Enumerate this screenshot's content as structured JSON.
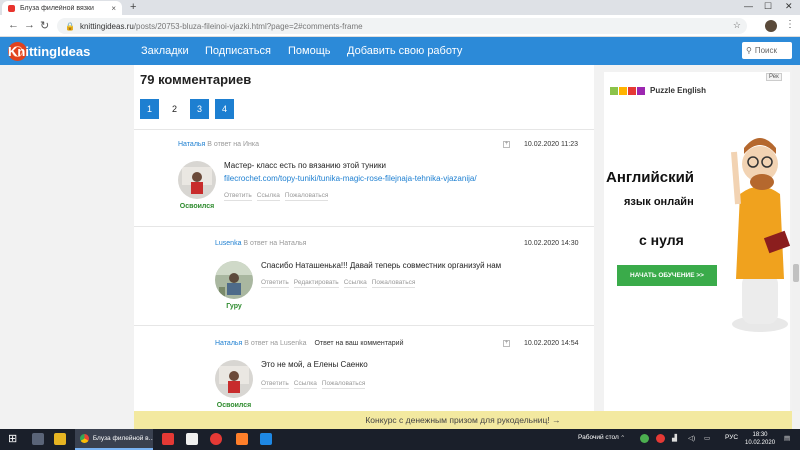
{
  "browser": {
    "tab_title": "Блуза филейной вязки",
    "url_host": "knittingideas.ru",
    "url_path": "/posts/20753-bluza-fileinoi-vjazki.html?page=2#comments-frame"
  },
  "site": {
    "logo_text": "KnittingIdeas",
    "nav": [
      "Закладки",
      "Подписаться",
      "Помощь",
      "Добавить свою работу"
    ],
    "search_placeholder": "Поиск"
  },
  "comments_header": {
    "count_text": "79 комментариев",
    "pages": [
      "1",
      "2",
      "3",
      "4"
    ],
    "current_page": "2"
  },
  "comments": [
    {
      "author": "Наталья",
      "reply_to": "В ответ на Инка",
      "date": "10.02.2020 11:23",
      "text": "Мастер- класс есть по вязанию этой туники",
      "link": "filecrochet.com/topy-tuniki/tunika-magic-rose-filejnaja-tehnika-vjazanija/",
      "rank": "Освоился",
      "actions": [
        "Ответить",
        "Ссылка",
        "Пожаловаться"
      ]
    },
    {
      "author": "Lusenka",
      "reply_to": "В ответ на Наталья",
      "date": "10.02.2020 14:30",
      "text": "Спасибо Наташенька!!! Давай теперь совместник организуй нам",
      "rank": "Гуру",
      "actions": [
        "Ответить",
        "Редактировать",
        "Ссылка",
        "Пожаловаться"
      ]
    },
    {
      "author": "Наталья",
      "reply_to": "В ответ на Lusenka",
      "badge": "Ответ на ваш комментарий",
      "date": "10.02.2020 14:54",
      "text": "Это не мой, а Елены Саенко",
      "rank": "Освоился",
      "actions": [
        "Ответить",
        "Ссылка",
        "Пожаловаться"
      ]
    }
  ],
  "ad": {
    "flag": "Рек",
    "brand": "Puzzle English",
    "line1": "Английский",
    "line2": "язык онлайн",
    "line3": "с нуля",
    "cta": "НАЧАТЬ ОБУЧЕНИЕ >>"
  },
  "promo_text": "Конкурс с денежным призом для рукодельниц! →",
  "taskbar": {
    "app_label": "Блуза филейной в...",
    "desktop_label": "Рабочий стол",
    "lang": "РУС",
    "time": "18:30",
    "date": "10.02.2020"
  },
  "colors": {
    "site_blue": "#2c8ad8",
    "link_blue": "#1d7fd1",
    "rank_green": "#2e8b2e",
    "cta_green": "#3aab4a",
    "promo_yellow": "#f3e9a0"
  }
}
